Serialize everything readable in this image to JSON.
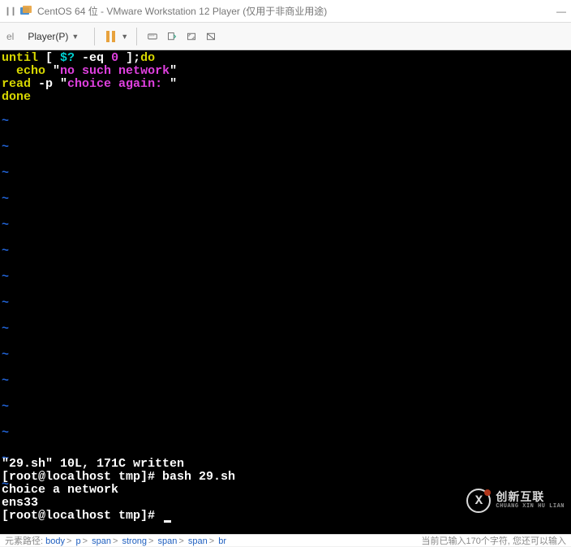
{
  "titlebar": {
    "title": "CentOS 64 位 - VMware Workstation 12 Player (仅用于非商业用途)"
  },
  "toolbar": {
    "left_label": "el",
    "player_label": "Player(P)"
  },
  "terminal": {
    "code": {
      "l1_kw1": "until",
      "l1_bracket1": " [ ",
      "l1_var": "$?",
      "l1_op": " -eq ",
      "l1_num": "0",
      "l1_bracket2": " ];",
      "l1_kw2": "do",
      "l2_indent": "  ",
      "l2_kw": "echo",
      "l2_q1": " \"",
      "l2_str": "no such network",
      "l2_q2": "\"",
      "l3_kw": "read",
      "l3_flag": " -p ",
      "l3_q1": "\"",
      "l3_str": "choice again: ",
      "l3_q2": "\"",
      "l4_kw": "done"
    },
    "bottom": {
      "l1": "\"29.sh\" 10L, 171C written",
      "l2": "[root@localhost tmp]# bash 29.sh",
      "l3": "choice a network",
      "l4": "ens33",
      "l5_prompt": "[root@localhost tmp]# "
    }
  },
  "watermark": {
    "logo_letter": "X",
    "text_big": "创新互联",
    "text_small": "CHUANG XIN HU LIAN"
  },
  "breadcrumb": {
    "prefix": "元素路径:",
    "items": [
      "body",
      "p",
      "span",
      "strong",
      "span",
      "span",
      "br"
    ],
    "right_text": "当前已输入170个字符, 您还可以输入"
  }
}
